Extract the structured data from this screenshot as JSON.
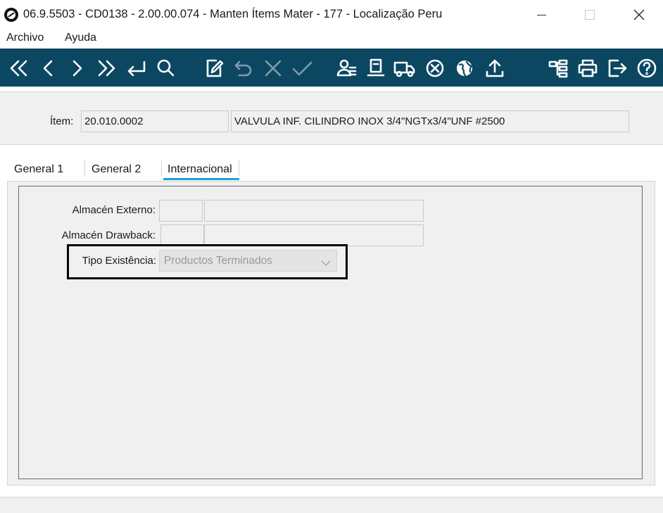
{
  "window": {
    "title": "06.9.5503 - CD0138 - 2.00.00.074 - Manten Ítems Mater - 177 - Localização Peru",
    "logo_icon": "totvs-logo-icon",
    "controls": [
      "minimize-icon",
      "maximize-icon",
      "close-icon"
    ]
  },
  "menu": {
    "items": [
      {
        "label": "Archivo"
      },
      {
        "label": "Ayuda"
      }
    ]
  },
  "toolbar": {
    "background_color": "#0c4762",
    "icon_color": "#ffffff",
    "disabled_icon_color": "#7f9cab",
    "buttons": [
      {
        "icon": "first-record-icon",
        "enabled": true
      },
      {
        "icon": "previous-record-icon",
        "enabled": true
      },
      {
        "icon": "next-record-icon",
        "enabled": true
      },
      {
        "icon": "last-record-icon",
        "enabled": true
      },
      {
        "icon": "goto-icon",
        "enabled": true
      },
      {
        "icon": "search-icon",
        "enabled": true
      },
      {
        "icon": "edit-icon",
        "enabled": true
      },
      {
        "icon": "undo-icon",
        "enabled": false
      },
      {
        "icon": "cancel-icon",
        "enabled": false
      },
      {
        "icon": "confirm-icon",
        "enabled": false
      },
      {
        "icon": "users-icon",
        "enabled": true
      },
      {
        "icon": "document-icon",
        "enabled": true
      },
      {
        "icon": "truck-icon",
        "enabled": true
      },
      {
        "icon": "delete-circle-icon",
        "enabled": true
      },
      {
        "icon": "globe-icon",
        "enabled": true
      },
      {
        "icon": "upload-icon",
        "enabled": true
      },
      {
        "icon": "structure-icon",
        "enabled": true
      },
      {
        "icon": "print-icon",
        "enabled": true
      },
      {
        "icon": "exit-icon",
        "enabled": true
      },
      {
        "icon": "help-icon",
        "enabled": true
      }
    ]
  },
  "header": {
    "item_label": "Ítem:",
    "item_code": "20.010.0002",
    "item_description": "VALVULA INF. CILINDRO INOX 3/4\"NGTx3/4\"UNF #2500"
  },
  "tabs": [
    {
      "label": "General 1",
      "active": false
    },
    {
      "label": "General 2",
      "active": false
    },
    {
      "label": "Internacional",
      "active": true
    }
  ],
  "tab_accent_color": "#1f9fd9",
  "internacional": {
    "almacen_externo": {
      "label": "Almacén Externo:",
      "code": "",
      "description": ""
    },
    "almacen_drawback": {
      "label": "Almacén Drawback:",
      "code": "",
      "description": ""
    },
    "tipo_existencia": {
      "label": "Tipo Existência:",
      "value": "Productos Terminados",
      "enabled": false
    }
  },
  "annotation": {
    "highlight_color": "#000000",
    "target": "tipo_existencia"
  }
}
